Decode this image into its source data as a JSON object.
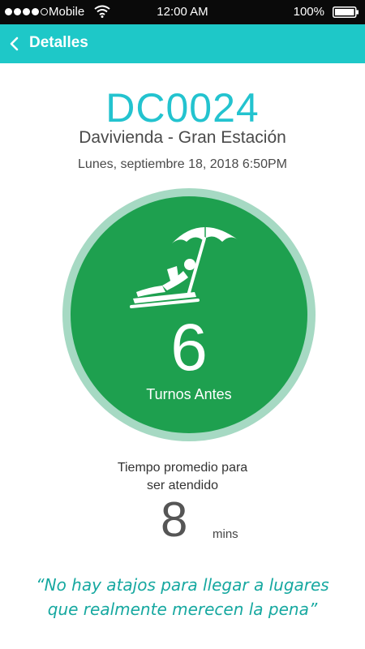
{
  "status_bar": {
    "carrier": "Mobile",
    "time": "12:00 AM",
    "battery": "100%"
  },
  "nav": {
    "title": "Detalles"
  },
  "ticket": {
    "code": "DC0024",
    "branch": "Davivienda - Gran Estación",
    "datetime": "Lunes, septiembre 18, 2018 6:50PM"
  },
  "turns": {
    "count": "6",
    "label": "Turnos Antes"
  },
  "wait": {
    "label_line1": "Tiempo promedio para",
    "label_line2": "ser atendido",
    "value": "8",
    "unit": "mins"
  },
  "quote": {
    "line1": "“No hay atajos para llegar a lugares",
    "line2": "que realmente merecen la pena”"
  },
  "colors": {
    "nav": "#1ec8c8",
    "accent": "#23c3cf",
    "circle": "#1ea04f",
    "circle_ring": "#a6d9c3",
    "quote": "#16a8a0"
  },
  "icons": {
    "back": "chevron-left-icon",
    "hero": "beach-umbrella-icon"
  }
}
